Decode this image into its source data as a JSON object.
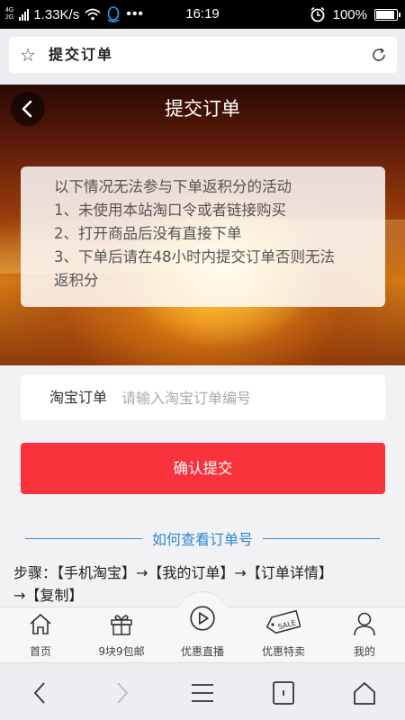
{
  "status_bar": {
    "network_top": "4G",
    "network_bottom": "2G",
    "speed": "1.33K/s",
    "time": "16:19",
    "battery": "100%",
    "battery_level": 1.0
  },
  "address_bar": {
    "title": "提交订单"
  },
  "header": {
    "title": "提交订单"
  },
  "notice": {
    "lines": [
      "以下情况无法参与下单返积分的活动",
      "1、未使用本站淘口令或者链接购买",
      "2、打开商品后没有直接下单",
      "3、下单后请在48小时内提交订单否则无法",
      "返积分"
    ]
  },
  "form": {
    "label": "淘宝订单",
    "value": "",
    "placeholder": "请输入淘宝订单编号",
    "submit_label": "确认提交"
  },
  "howto": {
    "title": "如何查看订单号",
    "steps_line1": "步骤：【手机淘宝】→【我的订单】→【订单详情】",
    "steps_line2": "→【复制】"
  },
  "tabs": [
    {
      "label": "首页",
      "icon": "home-icon"
    },
    {
      "label": "9块9包邮",
      "icon": "gift-icon"
    },
    {
      "label": "优惠直播",
      "icon": "play-icon"
    },
    {
      "label": "优惠特卖",
      "icon": "sale-tag-icon"
    },
    {
      "label": "我的",
      "icon": "user-icon"
    }
  ],
  "colors": {
    "submit": "#f8333b",
    "accent_blue": "#2f87d0"
  }
}
